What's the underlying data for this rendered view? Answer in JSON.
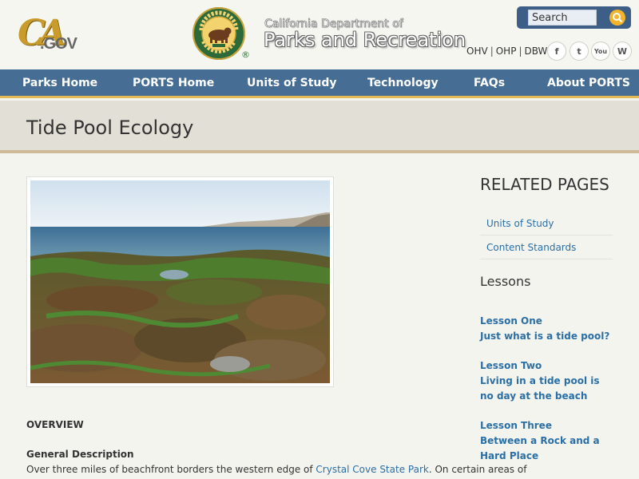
{
  "header": {
    "ca_logo": "CA",
    "ca_logo_suffix": ".GOV",
    "seal_text": "CALIFORNIA STATE PARKS",
    "seal_year": "SINCE 1864",
    "registered": "®",
    "dept_line1": "California Department of",
    "dept_line2": "Parks and Recreation",
    "search": {
      "placeholder": "Search"
    },
    "util_links": [
      "OHV",
      "OHP",
      "DBW"
    ],
    "util_sep": "|",
    "social_icons": [
      "facebook-icon",
      "twitter-icon",
      "youtube-icon",
      "wordpress-icon"
    ],
    "social_glyphs": [
      "f",
      "t",
      "You",
      "W"
    ]
  },
  "nav": {
    "items": [
      "Parks Home",
      "PORTS Home",
      "Units of Study",
      "Technology",
      "FAQs",
      "About PORTS"
    ]
  },
  "page": {
    "title": "Tide Pool Ecology"
  },
  "main": {
    "overview_heading": "OVERVIEW",
    "general_heading": "General Description",
    "body_prefix": "Over three miles of beachfront borders the western edge of ",
    "body_link": "Crystal Cove State Park",
    "body_suffix": ".  On certain areas of"
  },
  "sidebar": {
    "related_title": "RELATED PAGES",
    "related_links": [
      "Units of Study",
      "Content Standards"
    ],
    "lessons_title": "Lessons",
    "lessons": [
      {
        "label": "Lesson One",
        "title": "Just what is a tide pool?"
      },
      {
        "label": "Lesson Two",
        "title": "Living in a tide pool is no day at the beach"
      },
      {
        "label": "Lesson Three",
        "title": "Between a Rock and a Hard Place"
      }
    ]
  },
  "colors": {
    "nav_bg": "#466d94",
    "nav_border": "#e2b955",
    "link": "#2a6fa6",
    "search_bg": "#3d5f87",
    "search_btn": "#f1b52c"
  }
}
